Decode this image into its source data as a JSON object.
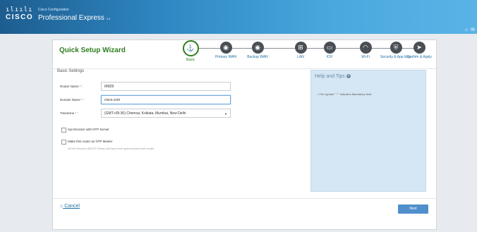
{
  "app": {
    "logo_bars": "ılıılı",
    "logo_word": "CISCO",
    "subtitle": "Cisco Configuration",
    "title": "Professional Express",
    "version": "3.4"
  },
  "top_icons": {
    "home": "⌂",
    "mail": "✉"
  },
  "wizard": {
    "title": "Quick Setup Wizard",
    "steps": [
      {
        "label": "Basic",
        "icon": "⚓",
        "active": true
      },
      {
        "label": "Primary WAN",
        "icon": "◉"
      },
      {
        "label": "Backup WAN",
        "icon": "◉"
      },
      {
        "label": "LAN",
        "icon": "⊞"
      },
      {
        "label": "IOX",
        "icon": "▭"
      },
      {
        "label": "Wi-Fi",
        "icon": "◠"
      },
      {
        "label": "Security & App Exp.",
        "icon": "⛨"
      },
      {
        "label": "Confirm & Apply",
        "icon": "➤"
      }
    ]
  },
  "form": {
    "section_title": "Basic Settings",
    "router_name": {
      "label": "Router Name",
      "required": "*",
      "colon": ":",
      "value": "IR829"
    },
    "domain_name": {
      "label": "Domain Name",
      "required": "*",
      "colon": ":",
      "value": "cisco.com"
    },
    "timezone": {
      "label": "TimeZone",
      "required": "*",
      "colon": ":",
      "value": "(GMT+05:30) Chennai, Kolkata, Mumbai, New Delhi"
    },
    "ntp_server": {
      "label": "Synchronize with NTP Server"
    },
    "ntp_master": {
      "label": "Make this router as NTP Master",
      "hint": "All the Devices (DHCP Client) will have time synchronized with router"
    }
  },
  "help": {
    "title": "Help and Tips",
    "icon": "?",
    "tip": "• The symbol \" * \" indicates Mandatory field."
  },
  "footer": {
    "cancel": "Cancel",
    "next": "Next"
  }
}
